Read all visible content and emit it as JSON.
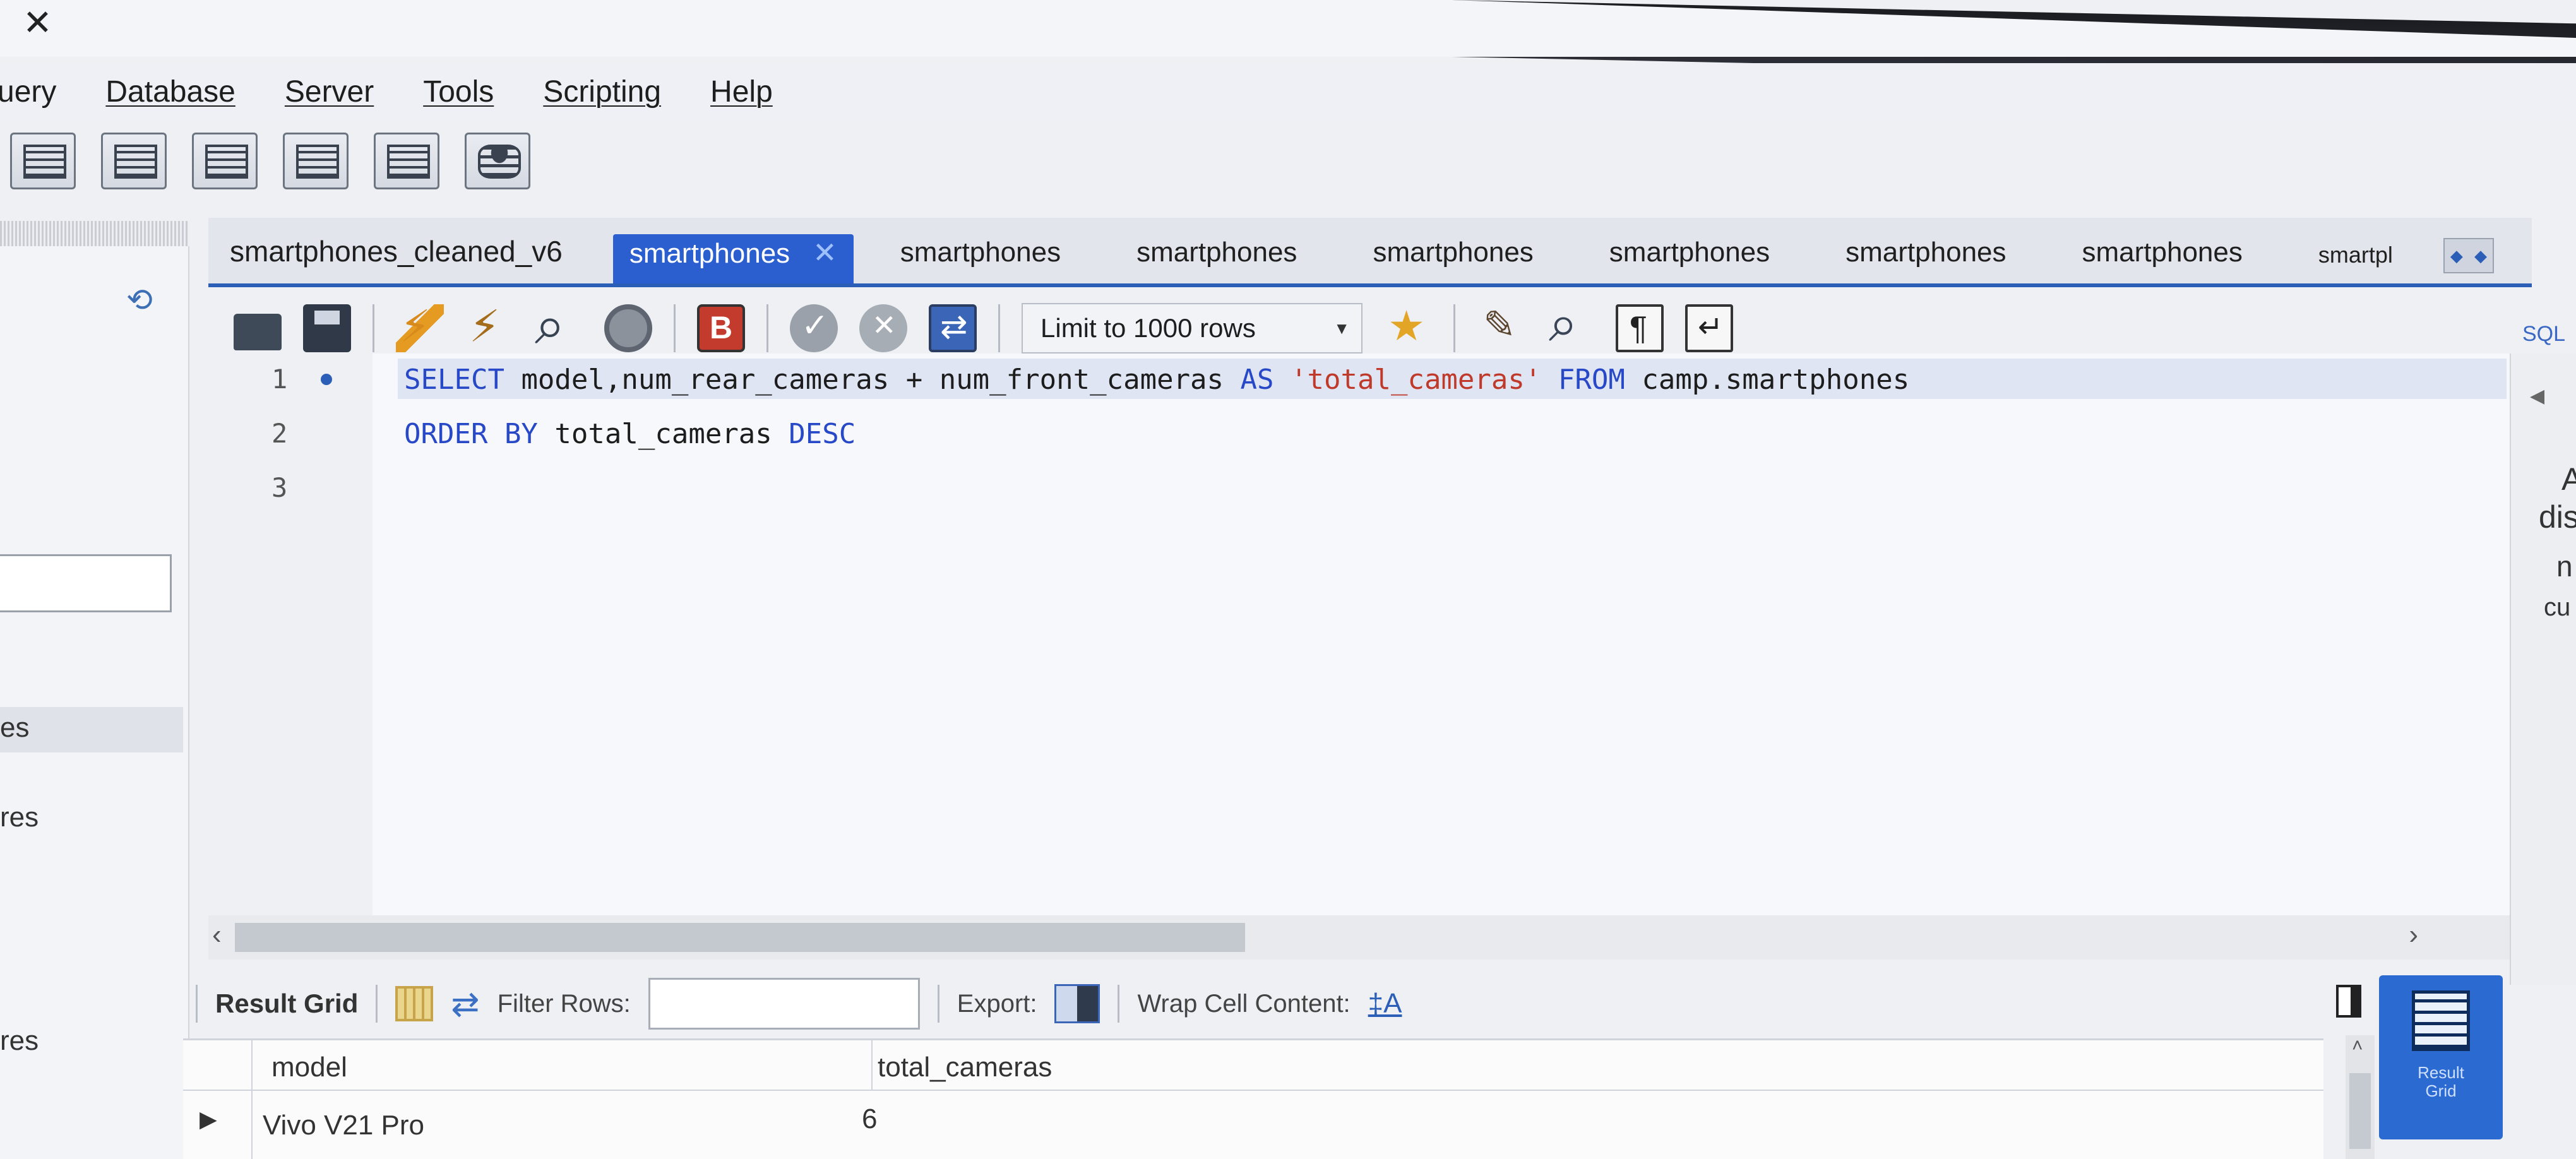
{
  "window": {
    "close_glyph": "✕"
  },
  "menu": {
    "items": [
      "uery",
      "Database",
      "Server",
      "Tools",
      "Scripting",
      "Help"
    ]
  },
  "toolbar_icons": [
    "new-sql-tab-icon",
    "open-sql-icon",
    "inspect-icon",
    "create-table-icon",
    "schema-inspector-icon",
    "reconnect-icon"
  ],
  "navigator": {
    "labels": [
      "es",
      "res",
      "res"
    ]
  },
  "tabs": {
    "items": [
      "smartphones_cleaned_v6",
      "smartphones",
      "smartphones",
      "smartphones",
      "smartphones",
      "smartphones",
      "smartphones",
      "smartphones",
      "smartpl"
    ],
    "active_index": 1,
    "close_glyph": "✕",
    "right_edge": "SQL"
  },
  "editor_toolbar": {
    "limit_label": "Limit to 1000 rows"
  },
  "editor": {
    "lines": [
      {
        "number": "1",
        "tokens": [
          {
            "t": "SELECT",
            "c": "kw"
          },
          {
            "t": " model,num_rear_cameras + num_front_cameras ",
            "c": ""
          },
          {
            "t": "AS",
            "c": "kw"
          },
          {
            "t": " ",
            "c": ""
          },
          {
            "t": "'total_cameras'",
            "c": "str"
          },
          {
            "t": " ",
            "c": ""
          },
          {
            "t": "FROM",
            "c": "kw"
          },
          {
            "t": " camp.smartphones",
            "c": ""
          }
        ]
      },
      {
        "number": "2",
        "tokens": [
          {
            "t": "ORDER BY",
            "c": "kw"
          },
          {
            "t": " total_cameras ",
            "c": ""
          },
          {
            "t": "DESC",
            "c": "kw"
          }
        ]
      },
      {
        "number": "3",
        "tokens": []
      }
    ]
  },
  "results": {
    "tab_label": "Result Grid",
    "filter_label": "Filter Rows:",
    "filter_value": "",
    "export_label": "Export:",
    "wrap_label": "Wrap Cell Content:",
    "wrap_glyph": "‡A",
    "columns": [
      "model",
      "total_cameras"
    ],
    "rows": [
      [
        "Vivo V21 Pro",
        "6"
      ]
    ],
    "side_button_label": "Result Grid"
  },
  "right_panel": {
    "fragments": [
      "A",
      "dis",
      "n",
      "cu"
    ]
  },
  "colors": {
    "accent": "#2b5fd0",
    "keyword": "#2748c7",
    "string": "#c03a2b"
  }
}
